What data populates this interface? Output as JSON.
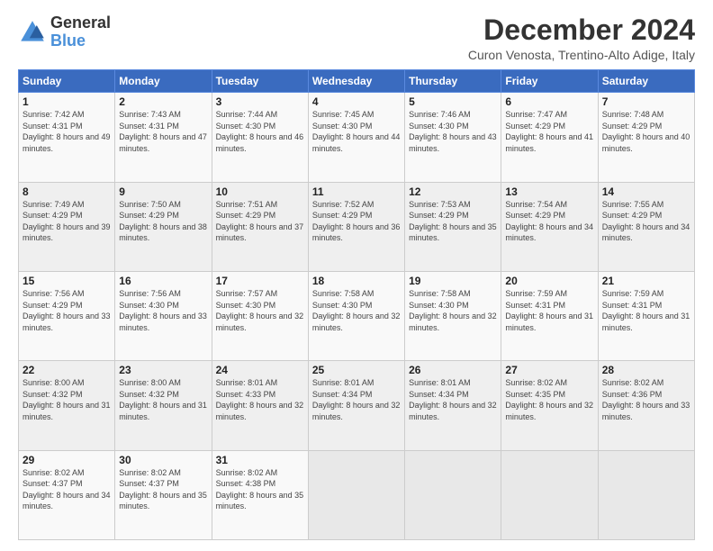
{
  "logo": {
    "general": "General",
    "blue": "Blue"
  },
  "header": {
    "month": "December 2024",
    "location": "Curon Venosta, Trentino-Alto Adige, Italy"
  },
  "days_of_week": [
    "Sunday",
    "Monday",
    "Tuesday",
    "Wednesday",
    "Thursday",
    "Friday",
    "Saturday"
  ],
  "weeks": [
    [
      {
        "day": "1",
        "sunrise": "7:42 AM",
        "sunset": "4:31 PM",
        "daylight": "8 hours and 49 minutes."
      },
      {
        "day": "2",
        "sunrise": "7:43 AM",
        "sunset": "4:31 PM",
        "daylight": "8 hours and 47 minutes."
      },
      {
        "day": "3",
        "sunrise": "7:44 AM",
        "sunset": "4:30 PM",
        "daylight": "8 hours and 46 minutes."
      },
      {
        "day": "4",
        "sunrise": "7:45 AM",
        "sunset": "4:30 PM",
        "daylight": "8 hours and 44 minutes."
      },
      {
        "day": "5",
        "sunrise": "7:46 AM",
        "sunset": "4:30 PM",
        "daylight": "8 hours and 43 minutes."
      },
      {
        "day": "6",
        "sunrise": "7:47 AM",
        "sunset": "4:29 PM",
        "daylight": "8 hours and 41 minutes."
      },
      {
        "day": "7",
        "sunrise": "7:48 AM",
        "sunset": "4:29 PM",
        "daylight": "8 hours and 40 minutes."
      }
    ],
    [
      {
        "day": "8",
        "sunrise": "7:49 AM",
        "sunset": "4:29 PM",
        "daylight": "8 hours and 39 minutes."
      },
      {
        "day": "9",
        "sunrise": "7:50 AM",
        "sunset": "4:29 PM",
        "daylight": "8 hours and 38 minutes."
      },
      {
        "day": "10",
        "sunrise": "7:51 AM",
        "sunset": "4:29 PM",
        "daylight": "8 hours and 37 minutes."
      },
      {
        "day": "11",
        "sunrise": "7:52 AM",
        "sunset": "4:29 PM",
        "daylight": "8 hours and 36 minutes."
      },
      {
        "day": "12",
        "sunrise": "7:53 AM",
        "sunset": "4:29 PM",
        "daylight": "8 hours and 35 minutes."
      },
      {
        "day": "13",
        "sunrise": "7:54 AM",
        "sunset": "4:29 PM",
        "daylight": "8 hours and 34 minutes."
      },
      {
        "day": "14",
        "sunrise": "7:55 AM",
        "sunset": "4:29 PM",
        "daylight": "8 hours and 34 minutes."
      }
    ],
    [
      {
        "day": "15",
        "sunrise": "7:56 AM",
        "sunset": "4:29 PM",
        "daylight": "8 hours and 33 minutes."
      },
      {
        "day": "16",
        "sunrise": "7:56 AM",
        "sunset": "4:30 PM",
        "daylight": "8 hours and 33 minutes."
      },
      {
        "day": "17",
        "sunrise": "7:57 AM",
        "sunset": "4:30 PM",
        "daylight": "8 hours and 32 minutes."
      },
      {
        "day": "18",
        "sunrise": "7:58 AM",
        "sunset": "4:30 PM",
        "daylight": "8 hours and 32 minutes."
      },
      {
        "day": "19",
        "sunrise": "7:58 AM",
        "sunset": "4:30 PM",
        "daylight": "8 hours and 32 minutes."
      },
      {
        "day": "20",
        "sunrise": "7:59 AM",
        "sunset": "4:31 PM",
        "daylight": "8 hours and 31 minutes."
      },
      {
        "day": "21",
        "sunrise": "7:59 AM",
        "sunset": "4:31 PM",
        "daylight": "8 hours and 31 minutes."
      }
    ],
    [
      {
        "day": "22",
        "sunrise": "8:00 AM",
        "sunset": "4:32 PM",
        "daylight": "8 hours and 31 minutes."
      },
      {
        "day": "23",
        "sunrise": "8:00 AM",
        "sunset": "4:32 PM",
        "daylight": "8 hours and 31 minutes."
      },
      {
        "day": "24",
        "sunrise": "8:01 AM",
        "sunset": "4:33 PM",
        "daylight": "8 hours and 32 minutes."
      },
      {
        "day": "25",
        "sunrise": "8:01 AM",
        "sunset": "4:34 PM",
        "daylight": "8 hours and 32 minutes."
      },
      {
        "day": "26",
        "sunrise": "8:01 AM",
        "sunset": "4:34 PM",
        "daylight": "8 hours and 32 minutes."
      },
      {
        "day": "27",
        "sunrise": "8:02 AM",
        "sunset": "4:35 PM",
        "daylight": "8 hours and 32 minutes."
      },
      {
        "day": "28",
        "sunrise": "8:02 AM",
        "sunset": "4:36 PM",
        "daylight": "8 hours and 33 minutes."
      }
    ],
    [
      {
        "day": "29",
        "sunrise": "8:02 AM",
        "sunset": "4:37 PM",
        "daylight": "8 hours and 34 minutes."
      },
      {
        "day": "30",
        "sunrise": "8:02 AM",
        "sunset": "4:37 PM",
        "daylight": "8 hours and 35 minutes."
      },
      {
        "day": "31",
        "sunrise": "8:02 AM",
        "sunset": "4:38 PM",
        "daylight": "8 hours and 35 minutes."
      },
      null,
      null,
      null,
      null
    ]
  ]
}
